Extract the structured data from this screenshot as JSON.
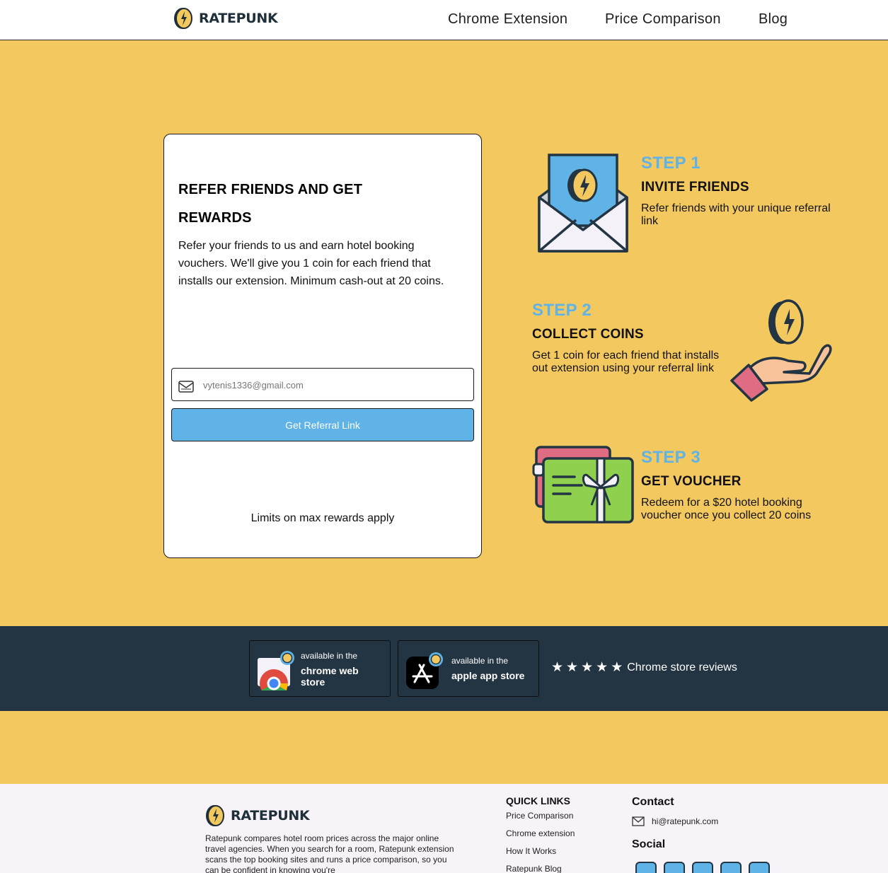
{
  "header": {
    "logo_text": "RATEPUNK",
    "nav": [
      "Chrome Extension",
      "Price Comparison",
      "Blog"
    ]
  },
  "referral_card": {
    "title": "REFER FRIENDS AND GET REWARDS",
    "description": "Refer your friends to us and earn hotel booking vouchers. We'll give you 1 coin for each friend that installs our extension. Minimum cash-out at 20 coins.",
    "email_value": "vytenis1336@gmail.com",
    "button_label": "Get Referral Link",
    "limits_text": "Limits on max rewards apply"
  },
  "steps": [
    {
      "label": "STEP 1",
      "title": "INVITE FRIENDS",
      "text": "Refer friends with your unique referral link",
      "icon": "envelope-coin-icon"
    },
    {
      "label": "STEP 2",
      "title": "COLLECT COINS",
      "text": "Get 1 coin for each friend that installs out extension using your referral link",
      "icon": "hand-coin-icon"
    },
    {
      "label": "STEP 3",
      "title": "GET VOUCHER",
      "text": "Redeem for a $20 hotel booking voucher once you collect 20 coins",
      "icon": "gift-voucher-icon"
    }
  ],
  "stores": {
    "chrome": {
      "small": "available in the",
      "big": "chrome web store"
    },
    "apple": {
      "small": "available in the",
      "big": "apple app store"
    },
    "reviews_label": "Chrome store reviews",
    "stars": 5
  },
  "footer": {
    "logo_text": "RATEPUNK",
    "description": "Ratepunk compares hotel room prices across the major online travel agencies. When you search for a room, Ratepunk extension scans the top booking sites and runs a price comparison, so you can be confident in knowing you're",
    "quick_links_heading": "QUICK LINKS",
    "quick_links": [
      "Price Comparison",
      "Chrome extension",
      "How It Works",
      "Ratepunk Blog"
    ],
    "contact_heading": "Contact",
    "email": "hi@ratepunk.com",
    "social_heading": "Social",
    "social_icons": [
      "instagram-icon",
      "facebook-icon",
      "linkedin-icon",
      "twitter-icon",
      "tiktok-icon"
    ]
  },
  "colors": {
    "background": "#F3C95F",
    "accent_blue": "#5FB3E6",
    "dark_navy": "#233442"
  }
}
